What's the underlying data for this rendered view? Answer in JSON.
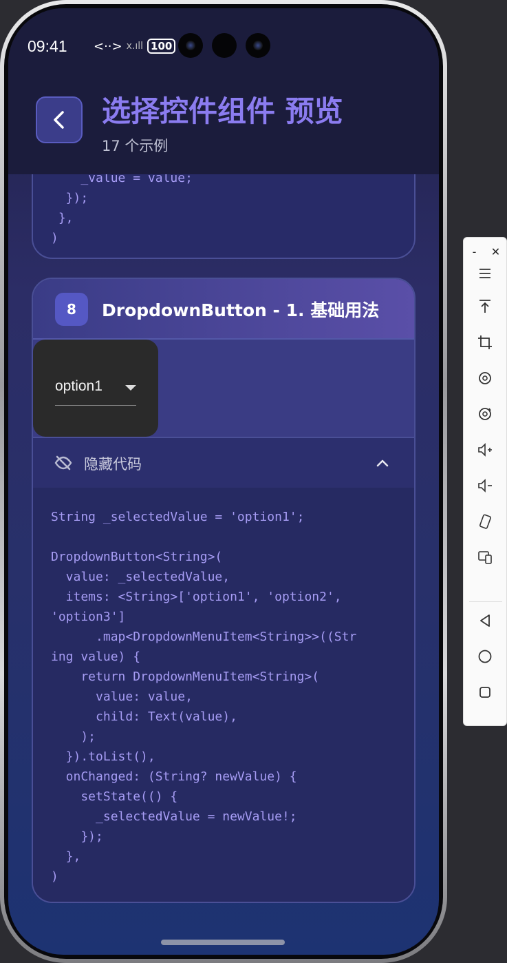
{
  "status_bar": {
    "time": "09:41",
    "network": "<··>",
    "signal_text": "x.ıll",
    "battery": "100"
  },
  "header": {
    "title": "选择控件组件 预览",
    "subtitle": "17 个示例"
  },
  "prev_card": {
    "code": "    _value = value;\n  });\n },\n)"
  },
  "card": {
    "number": "8",
    "title": "DropdownButton - 1. 基础用法",
    "dropdown_value": "option1",
    "toggle_label": "隐藏代码",
    "code": "String _selectedValue = 'option1';\n\nDropdownButton<String>(\n  value: _selectedValue,\n  items: <String>['option1', 'option2',\n'option3']\n      .map<DropdownMenuItem<String>>((Str\ning value) {\n    return DropdownMenuItem<String>(\n      value: value,\n      child: Text(value),\n    );\n  }).toList(),\n  onChanged: (String? newValue) {\n    setState(() {\n      _selectedValue = newValue!;\n    });\n  },\n)"
  },
  "toolbar": {
    "minimize": "-",
    "close": "✕"
  },
  "colors": {
    "accent": "#8b7cf0",
    "code_text": "#a69cf4",
    "header_bg": "#1b1c3c"
  }
}
